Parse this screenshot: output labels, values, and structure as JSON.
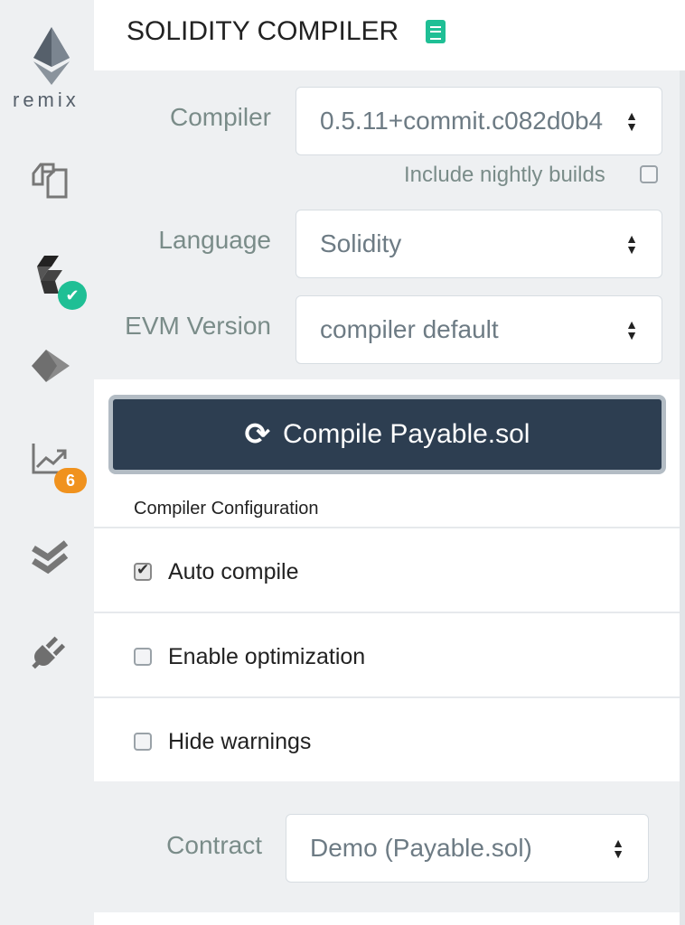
{
  "sidebar": {
    "logo_text": "remix",
    "items": [
      {
        "name": "file-explorer"
      },
      {
        "name": "solidity-compiler",
        "status": "success"
      },
      {
        "name": "deploy-run"
      },
      {
        "name": "analysis",
        "badge": "6"
      },
      {
        "name": "testing"
      },
      {
        "name": "plugin-manager"
      }
    ]
  },
  "header": {
    "title": "SOLIDITY COMPILER"
  },
  "compiler": {
    "label": "Compiler",
    "value": "0.5.11+commit.c082d0b4",
    "nightly_label": "Include nightly builds",
    "nightly_checked": false
  },
  "language": {
    "label": "Language",
    "value": "Solidity"
  },
  "evm": {
    "label": "EVM Version",
    "value": "compiler default"
  },
  "compile_button": {
    "label": "Compile Payable.sol"
  },
  "config": {
    "title": "Compiler Configuration",
    "options": [
      {
        "label": "Auto compile",
        "checked": true
      },
      {
        "label": "Enable optimization",
        "checked": false
      },
      {
        "label": "Hide warnings",
        "checked": false
      }
    ]
  },
  "contract": {
    "label": "Contract",
    "value": "Demo (Payable.sol)"
  },
  "colors": {
    "accent": "#1fbf95",
    "button": "#2d3e51",
    "badge_warning": "#f0921e"
  }
}
